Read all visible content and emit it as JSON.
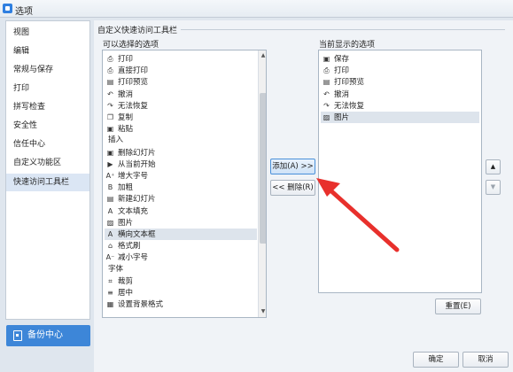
{
  "window": {
    "title": "选项"
  },
  "sidebar": {
    "items": [
      {
        "label": "视图"
      },
      {
        "label": "编辑"
      },
      {
        "label": "常规与保存"
      },
      {
        "label": "打印"
      },
      {
        "label": "拼写检查"
      },
      {
        "label": "安全性"
      },
      {
        "label": "信任中心"
      },
      {
        "label": "自定义功能区"
      },
      {
        "label": "快速访问工具栏",
        "active": true
      }
    ],
    "backup_label": "备份中心"
  },
  "panel": {
    "group_title": "自定义快速访问工具栏",
    "available_label": "可以选择的选项",
    "current_label": "当前显示的选项",
    "available_items": [
      {
        "icon": "print-icon",
        "glyph": "⎙",
        "label": "打印"
      },
      {
        "icon": "direct-print-icon",
        "glyph": "⎙",
        "label": "直接打印"
      },
      {
        "icon": "print-preview-icon",
        "glyph": "▤",
        "label": "打印预览"
      },
      {
        "icon": "undo-icon",
        "glyph": "↶",
        "label": "撤消"
      },
      {
        "icon": "redo-icon",
        "glyph": "↷",
        "label": "无法恢复"
      },
      {
        "icon": "copy-icon",
        "glyph": "❐",
        "label": "复制"
      },
      {
        "icon": "paste-icon",
        "glyph": "▣",
        "label": "粘贴"
      },
      {
        "category": true,
        "label": "插入"
      },
      {
        "icon": "delete-slide-icon",
        "glyph": "▣",
        "label": "删除幻灯片"
      },
      {
        "icon": "play-icon",
        "glyph": "▶",
        "label": "从当前开始"
      },
      {
        "icon": "font-increase-icon",
        "glyph": "A⁺",
        "label": "增大字号"
      },
      {
        "icon": "bold-icon",
        "glyph": "B",
        "label": "加粗"
      },
      {
        "icon": "new-slide-icon",
        "glyph": "▤",
        "label": "新建幻灯片"
      },
      {
        "icon": "text-fill-icon",
        "glyph": "A",
        "label": "文本填充"
      },
      {
        "icon": "image-icon",
        "glyph": "▨",
        "label": "图片"
      },
      {
        "icon": "textbox-icon",
        "glyph": "A",
        "label": "横向文本框",
        "selected": true
      },
      {
        "icon": "format-painter-icon",
        "glyph": "⌂",
        "label": "格式刷"
      },
      {
        "icon": "font-decrease-icon",
        "glyph": "A⁻",
        "label": "减小字号"
      },
      {
        "category": true,
        "label": "字体"
      },
      {
        "icon": "crop-icon",
        "glyph": "⌗",
        "label": "裁剪"
      },
      {
        "icon": "align-center-icon",
        "glyph": "≡",
        "label": "居中"
      },
      {
        "icon": "background-icon",
        "glyph": "▦",
        "label": "设置背景格式"
      }
    ],
    "current_items": [
      {
        "icon": "save-icon",
        "glyph": "▣",
        "label": "保存"
      },
      {
        "icon": "print-icon",
        "glyph": "⎙",
        "label": "打印"
      },
      {
        "icon": "print-preview-icon",
        "glyph": "▤",
        "label": "打印预览"
      },
      {
        "icon": "undo-icon",
        "glyph": "↶",
        "label": "撤消"
      },
      {
        "icon": "redo-icon",
        "glyph": "↷",
        "label": "无法恢复"
      },
      {
        "icon": "image-icon",
        "glyph": "▨",
        "label": "图片",
        "selected": true
      }
    ],
    "add_label": "添加(A) >>",
    "remove_label": "<< 删除(R)",
    "reset_label": "重置(E)",
    "move_up_glyph": "▲",
    "move_down_glyph": "▼"
  },
  "footer": {
    "ok_label": "确定",
    "cancel_label": "取消"
  },
  "colors": {
    "accent": "#3d86d8",
    "annotation_arrow": "#e8302c"
  }
}
